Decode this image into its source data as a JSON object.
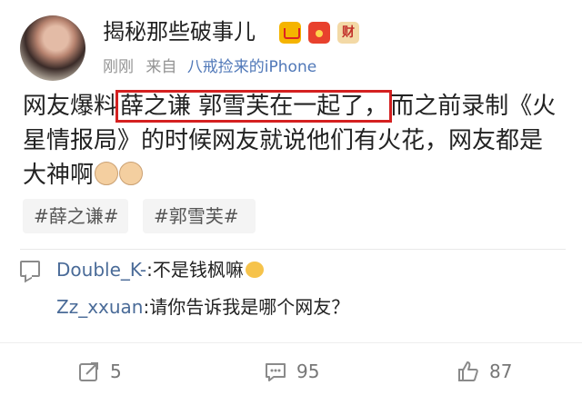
{
  "post": {
    "username": "揭秘那些破事儿",
    "badges": {
      "crown": "crown-badge-icon",
      "hongbao": "red-envelope-icon",
      "cai": "财"
    },
    "time": "刚刚",
    "source_prefix": "来自",
    "source": "八戒捡来的iPhone",
    "text": {
      "line1_before": "网友爆料",
      "line1_highlight": "薛之谦 郭雪芙在一起了，",
      "line1_after": "而之前录制《火",
      "line2": "星情报局》的时候网友就说他们有火花，网友都是",
      "line3": "大神啊"
    },
    "tags": [
      "#薛之谦#",
      "#郭雪芙#"
    ]
  },
  "comments": [
    {
      "name": "Double_K-",
      "text": ":不是钱枫嘛"
    },
    {
      "name": "Zz_xxuan",
      "text": ":请你告诉我是哪个网友？"
    }
  ],
  "actions": {
    "share_count": "5",
    "comment_count": "95",
    "like_count": "87"
  },
  "colors": {
    "link": "#5078b8",
    "highlight_border": "#d42020",
    "comment_name": "#4a6b98"
  }
}
